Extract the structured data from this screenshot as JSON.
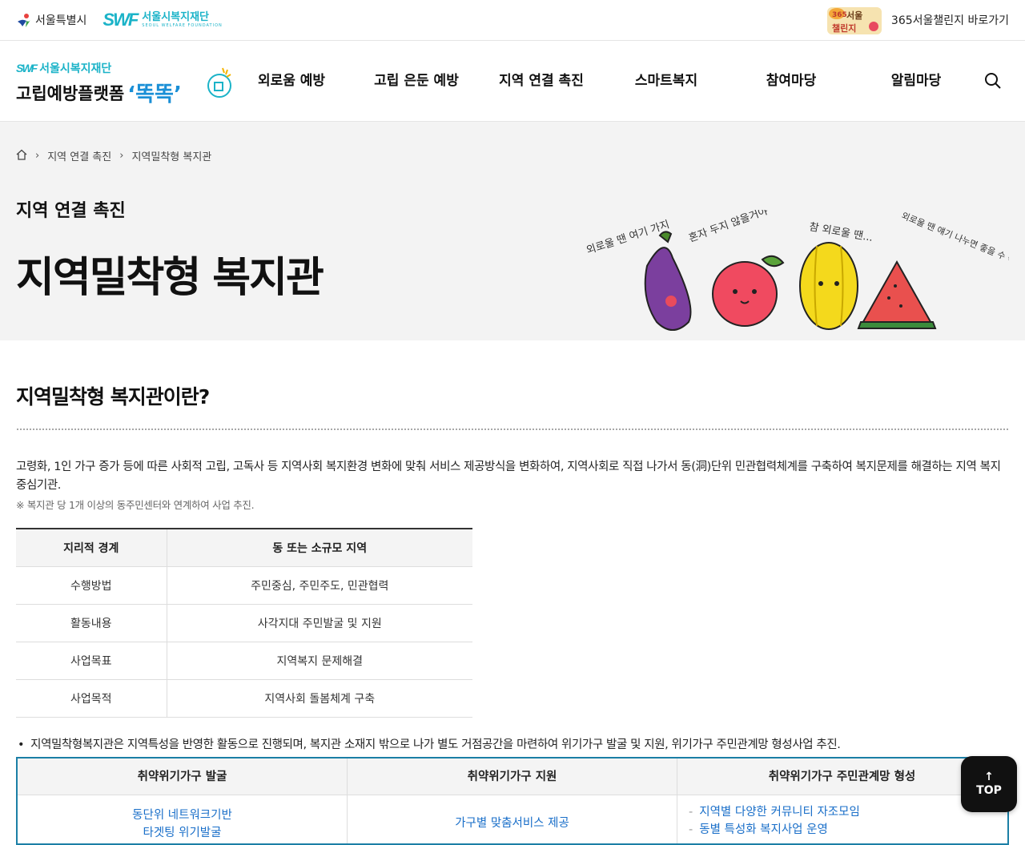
{
  "topbar": {
    "seoul_logo": "서울특별시",
    "swf_mark": "SWF",
    "swf_name": "서울시복지재단",
    "swf_en": "SEOUL WELFARE FOUNDATION",
    "challenge_badge": "365 서울챌린지",
    "challenge_link": "365서울챌린지 바로가기"
  },
  "brand": {
    "mark": "SWF",
    "org": "서울시복지재단",
    "platform": "고립예방플랫폼",
    "name": "‘똑똑’"
  },
  "menu": [
    "외로움 예방",
    "고립 은둔 예방",
    "지역 연결 촉진",
    "스마트복지",
    "참여마당",
    "알림마당"
  ],
  "breadcrumb": [
    "지역 연결 촉진",
    "지역밀착형 복지관"
  ],
  "visual": {
    "category": "지역 연결 촉진",
    "title": "지역밀착형 복지관",
    "bubbles": [
      "외로울 땐 여기 가지",
      "혼자 두지 않을거야",
      "참 외로울 땐...",
      "외로울 땐 얘기 나누면 좋을 수 박에"
    ]
  },
  "section": {
    "title": "지역밀착형 복지관이란?",
    "desc": "고령화, 1인 가구 증가 등에 따른 사회적 고립, 고독사 등 지역사회 복지환경 변화에 맞춰 서비스 제공방식을 변화하여, 지역사회로 직접 나가서 동(洞)단위 민관협력체계를 구축하여 복지문제를 해결하는 지역 복지중심기관.",
    "note": "※ 복지관 당 1개 이상의 동주민센터와 연계하여 사업 추진."
  },
  "table1": {
    "headers": [
      "지리적 경계",
      "동 또는 소규모 지역"
    ],
    "rows": [
      [
        "수행방법",
        "주민중심, 주민주도, 민관협력"
      ],
      [
        "활동내용",
        "사각지대 주민발굴 및 지원"
      ],
      [
        "사업목표",
        "지역복지 문제해결"
      ],
      [
        "사업목적",
        "지역사회 돌봄체계 구축"
      ]
    ]
  },
  "bullet": "지역밀착형복지관은 지역특성을 반영한 활동으로 진행되며, 복지관 소재지 밖으로 나가 별도 거점공간을 마련하여 위기가구 발굴 및 지원, 위기가구 주민관계망 형성사업 추진.",
  "table2": {
    "headers": [
      "취약위기가구 발굴",
      "취약위기가구 지원",
      "취약위기가구 주민관계망 형성"
    ],
    "col1": [
      "동단위 네트워크기반",
      "타겟팅 위기발굴"
    ],
    "col2": [
      "가구별 맞춤서비스 제공"
    ],
    "col3": [
      "지역별 다양한 커뮤니티 자조모임",
      "동별 특성화 복지사업 운영"
    ]
  },
  "top_button": "TOP",
  "colors": {
    "accent": "#1bb3c8",
    "link": "#1a6fc9",
    "border_accent": "#1b7fa6"
  }
}
